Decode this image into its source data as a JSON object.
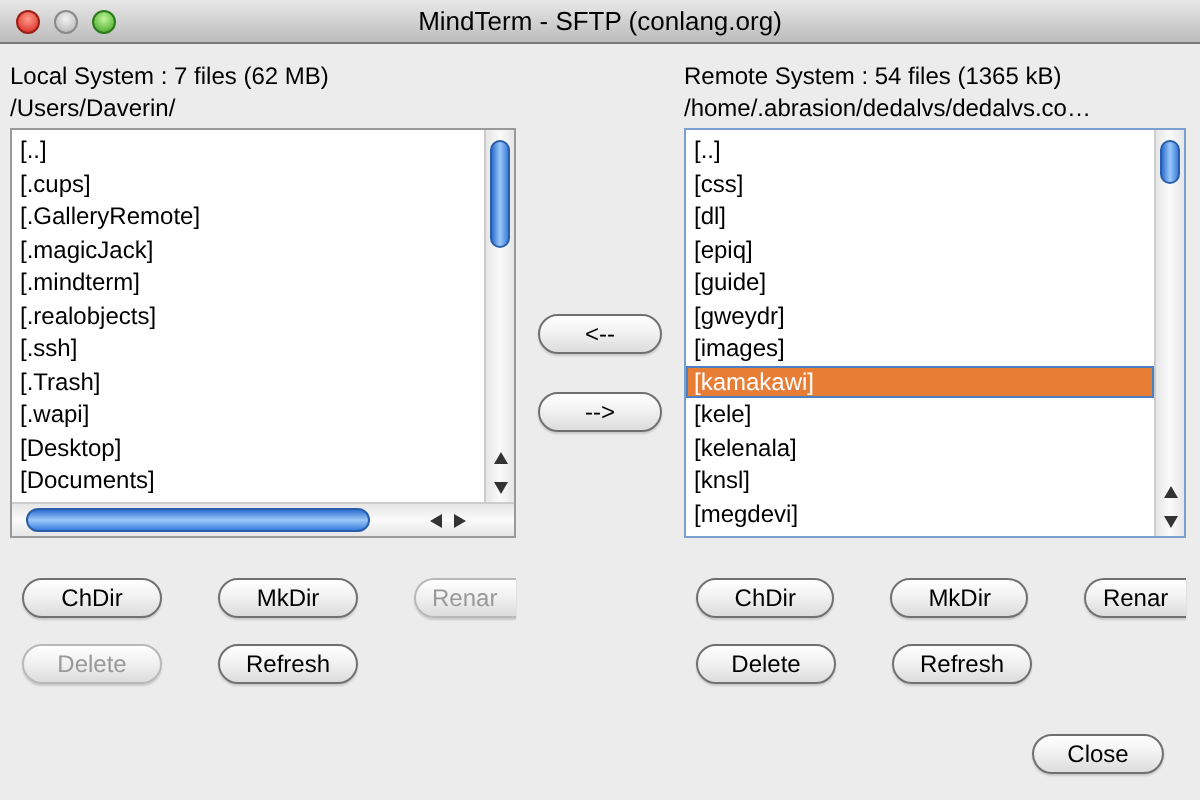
{
  "window": {
    "title": "MindTerm - SFTP (conlang.org)"
  },
  "local": {
    "summary": "Local System : 7 files (62 MB)",
    "path": "/Users/Daverin/",
    "files": [
      {
        "name": "[..]",
        "selected": false
      },
      {
        "name": "[.cups]",
        "selected": false
      },
      {
        "name": "[.GalleryRemote]",
        "selected": false
      },
      {
        "name": "[.magicJack]",
        "selected": false
      },
      {
        "name": "[.mindterm]",
        "selected": false
      },
      {
        "name": "[.realobjects]",
        "selected": false
      },
      {
        "name": "[.ssh]",
        "selected": false
      },
      {
        "name": "[.Trash]",
        "selected": false
      },
      {
        "name": "[.wapi]",
        "selected": false
      },
      {
        "name": "[Desktop]",
        "selected": false
      },
      {
        "name": "[Documents]",
        "selected": false
      }
    ],
    "buttons": [
      [
        {
          "label": "ChDir",
          "disabled": false
        },
        {
          "label": "MkDir",
          "disabled": false
        },
        {
          "label": "Renar",
          "disabled": true
        }
      ],
      [
        {
          "label": "Delete",
          "disabled": true
        },
        {
          "label": "Refresh",
          "disabled": false
        }
      ]
    ]
  },
  "transfer_buttons": [
    {
      "label": "<--"
    },
    {
      "label": "-->"
    }
  ],
  "remote": {
    "summary": "Remote System : 54 files (1365 kB)",
    "path": "/home/.abrasion/dedalvs/dedalvs.co…",
    "files": [
      {
        "name": "[..]",
        "selected": false
      },
      {
        "name": "[css]",
        "selected": false
      },
      {
        "name": "[dl]",
        "selected": false
      },
      {
        "name": "[epiq]",
        "selected": false
      },
      {
        "name": "[guide]",
        "selected": false
      },
      {
        "name": "[gweydr]",
        "selected": false
      },
      {
        "name": "[images]",
        "selected": false
      },
      {
        "name": "[kamakawi]",
        "selected": true
      },
      {
        "name": "[kele]",
        "selected": false
      },
      {
        "name": "[kelenala]",
        "selected": false
      },
      {
        "name": "[knsl]",
        "selected": false
      },
      {
        "name": "[megdevi]",
        "selected": false
      }
    ],
    "buttons": [
      [
        {
          "label": "ChDir",
          "disabled": false
        },
        {
          "label": "MkDir",
          "disabled": false
        },
        {
          "label": "Renar",
          "disabled": false
        }
      ],
      [
        {
          "label": "Delete",
          "disabled": false
        },
        {
          "label": "Refresh",
          "disabled": false
        }
      ]
    ]
  },
  "close_button": {
    "label": "Close"
  }
}
